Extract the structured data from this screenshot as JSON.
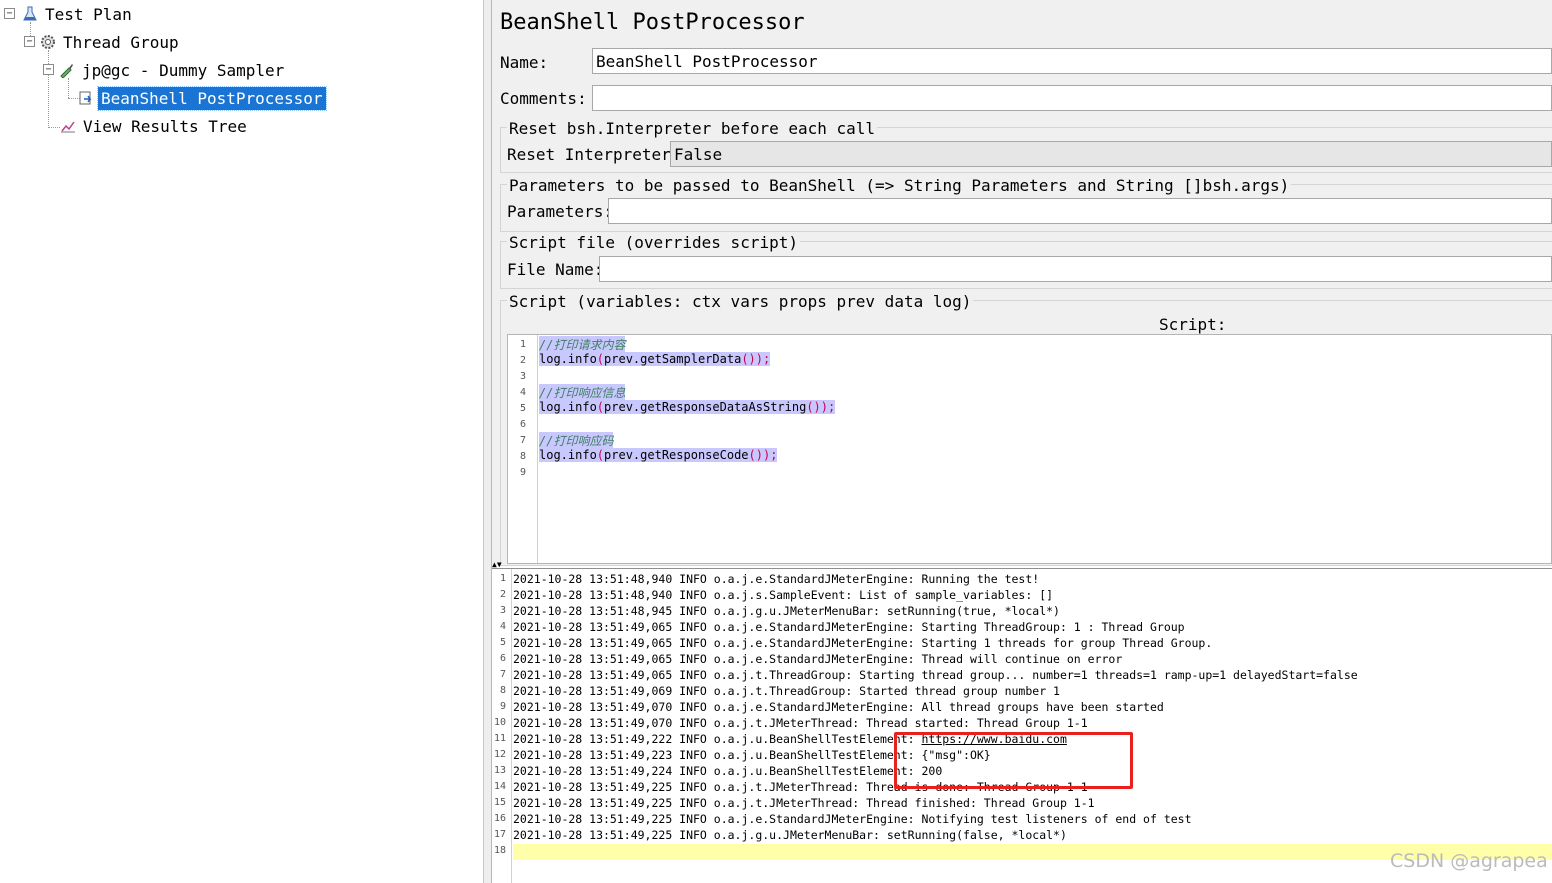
{
  "tree": {
    "test_plan": "Test Plan",
    "thread_group": "Thread Group",
    "dummy_sampler": "jp@gc - Dummy Sampler",
    "beanshell": "BeanShell PostProcessor",
    "results_tree": "View Results Tree"
  },
  "panel": {
    "title": "BeanShell PostProcessor",
    "name_label": "Name:",
    "name_value": "BeanShell PostProcessor",
    "comments_label": "Comments:",
    "comments_value": "",
    "reset_group": "Reset bsh.Interpreter before each call",
    "reset_label": "Reset Interpreter:",
    "reset_value": "False",
    "params_group": "Parameters to be passed to BeanShell (=> String Parameters and String []bsh.args)",
    "params_label": "Parameters:",
    "params_value": "",
    "file_group": "Script file (overrides script)",
    "file_label": "File Name:",
    "file_value": "",
    "script_group": "Script (variables: ctx vars props prev data log)",
    "script_label": "Script:"
  },
  "script": {
    "line_numbers": [
      "1",
      "2",
      "3",
      "4",
      "5",
      "6",
      "7",
      "8",
      "9"
    ],
    "c1": "//打印请求内容",
    "l2a": "log.info",
    "l2b": "(",
    "l2c": "prev.getSamplerData",
    "l2d": "());",
    "c4": "//打印响应信息",
    "l5a": "log.info",
    "l5b": "(",
    "l5c": "prev.getResponseDataAsString",
    "l5d": "());",
    "c7": "//打印响应码",
    "l8a": "log.info",
    "l8b": "(",
    "l8c": "prev.getResponseCode",
    "l8d": "());"
  },
  "log": {
    "line_numbers": [
      "1",
      "2",
      "3",
      "4",
      "5",
      "6",
      "7",
      "8",
      "9",
      "10",
      "11",
      "12",
      "13",
      "14",
      "15",
      "16",
      "17",
      "18"
    ],
    "lines": [
      "2021-10-28 13:51:48,940 INFO o.a.j.e.StandardJMeterEngine: Running the test!",
      "2021-10-28 13:51:48,940 INFO o.a.j.s.SampleEvent: List of sample_variables: []",
      "2021-10-28 13:51:48,945 INFO o.a.j.g.u.JMeterMenuBar: setRunning(true, *local*)",
      "2021-10-28 13:51:49,065 INFO o.a.j.e.StandardJMeterEngine: Starting ThreadGroup: 1 : Thread Group",
      "2021-10-28 13:51:49,065 INFO o.a.j.e.StandardJMeterEngine: Starting 1 threads for group Thread Group.",
      "2021-10-28 13:51:49,065 INFO o.a.j.e.StandardJMeterEngine: Thread will continue on error",
      "2021-10-28 13:51:49,065 INFO o.a.j.t.ThreadGroup: Starting thread group... number=1 threads=1 ramp-up=1 delayedStart=false",
      "2021-10-28 13:51:49,069 INFO o.a.j.t.ThreadGroup: Started thread group number 1",
      "2021-10-28 13:51:49,070 INFO o.a.j.e.StandardJMeterEngine: All thread groups have been started",
      "2021-10-28 13:51:49,070 INFO o.a.j.t.JMeterThread: Thread started: Thread Group 1-1",
      "2021-10-28 13:51:49,222 INFO o.a.j.u.BeanShellTestElement: ",
      "2021-10-28 13:51:49,223 INFO o.a.j.u.BeanShellTestElement: {\"msg\":OK}",
      "2021-10-28 13:51:49,224 INFO o.a.j.u.BeanShellTestElement: 200",
      "2021-10-28 13:51:49,225 INFO o.a.j.t.JMeterThread: Thread is done: Thread Group 1-1",
      "2021-10-28 13:51:49,225 INFO o.a.j.t.JMeterThread: Thread finished: Thread Group 1-1",
      "2021-10-28 13:51:49,225 INFO o.a.j.e.StandardJMeterEngine: Notifying test listeners of end of test",
      "2021-10-28 13:51:49,225 INFO o.a.j.g.u.JMeterMenuBar: setRunning(false, *local*)",
      ""
    ],
    "url": "https://www.baidu.com"
  },
  "watermark": "CSDN @agrapea",
  "colors": {
    "selection": "#1a74d4",
    "annotation": "#e8201e",
    "current_line": "#ffffaa"
  }
}
